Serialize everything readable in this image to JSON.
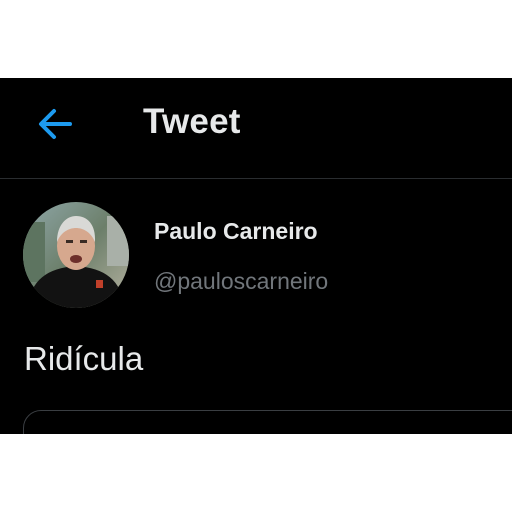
{
  "header": {
    "back_icon": "arrow-left-icon",
    "title": "Tweet"
  },
  "author": {
    "display_name": "Paulo Carneiro",
    "handle": "@pauloscarneiro",
    "avatar_alt": "Paulo Carneiro"
  },
  "tweet": {
    "text": "Ridícula"
  },
  "colors": {
    "background": "#000000",
    "accent": "#1d9bf0",
    "primary_text": "#e7e9ea",
    "secondary_text": "#71767b",
    "divider": "#2a2d30"
  }
}
